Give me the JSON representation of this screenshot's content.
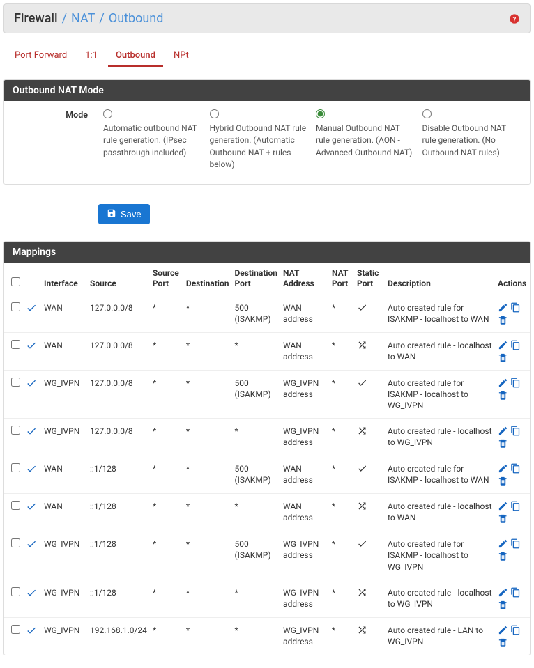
{
  "header": {
    "root": "Firewall",
    "segments": [
      "NAT",
      "Outbound"
    ]
  },
  "tabs": [
    {
      "label": "Port Forward",
      "active": false
    },
    {
      "label": "1:1",
      "active": false
    },
    {
      "label": "Outbound",
      "active": true
    },
    {
      "label": "NPt",
      "active": false
    }
  ],
  "mode_panel": {
    "title": "Outbound NAT Mode",
    "label": "Mode",
    "options": [
      {
        "desc": "Automatic outbound NAT rule generation. (IPsec passthrough included)",
        "selected": false
      },
      {
        "desc": "Hybrid Outbound NAT rule generation. (Automatic Outbound NAT + rules below)",
        "selected": false
      },
      {
        "desc": "Manual Outbound NAT rule generation. (AON - Advanced Outbound NAT)",
        "selected": true
      },
      {
        "desc": "Disable Outbound NAT rule generation. (No Outbound NAT rules)",
        "selected": false
      }
    ]
  },
  "save_label": "Save",
  "mappings_panel": {
    "title": "Mappings",
    "columns": [
      "",
      "",
      "Interface",
      "Source",
      "Source Port",
      "Destination",
      "Destination Port",
      "NAT Address",
      "NAT Port",
      "Static Port",
      "Description",
      "Actions"
    ],
    "rows": [
      {
        "interface": "WAN",
        "source": "127.0.0.0/8",
        "srcport": "*",
        "dst": "*",
        "dstport": "500 (ISAKMP)",
        "nataddr": "WAN address",
        "natport": "*",
        "static": "check",
        "desc": "Auto created rule for ISAKMP - localhost to WAN"
      },
      {
        "interface": "WAN",
        "source": "127.0.0.0/8",
        "srcport": "*",
        "dst": "*",
        "dstport": "*",
        "nataddr": "WAN address",
        "natport": "*",
        "static": "shuffle",
        "desc": "Auto created rule - localhost to WAN"
      },
      {
        "interface": "WG_IVPN",
        "source": "127.0.0.0/8",
        "srcport": "*",
        "dst": "*",
        "dstport": "500 (ISAKMP)",
        "nataddr": "WG_IVPN address",
        "natport": "*",
        "static": "check",
        "desc": "Auto created rule for ISAKMP - localhost to WG_IVPN"
      },
      {
        "interface": "WG_IVPN",
        "source": "127.0.0.0/8",
        "srcport": "*",
        "dst": "*",
        "dstport": "*",
        "nataddr": "WG_IVPN address",
        "natport": "*",
        "static": "shuffle",
        "desc": "Auto created rule - localhost to WG_IVPN"
      },
      {
        "interface": "WAN",
        "source": "::1/128",
        "srcport": "*",
        "dst": "*",
        "dstport": "500 (ISAKMP)",
        "nataddr": "WAN address",
        "natport": "*",
        "static": "check",
        "desc": "Auto created rule for ISAKMP - localhost to WAN"
      },
      {
        "interface": "WAN",
        "source": "::1/128",
        "srcport": "*",
        "dst": "*",
        "dstport": "*",
        "nataddr": "WAN address",
        "natport": "*",
        "static": "shuffle",
        "desc": "Auto created rule - localhost to WAN"
      },
      {
        "interface": "WG_IVPN",
        "source": "::1/128",
        "srcport": "*",
        "dst": "*",
        "dstport": "500 (ISAKMP)",
        "nataddr": "WG_IVPN address",
        "natport": "*",
        "static": "check",
        "desc": "Auto created rule for ISAKMP - localhost to WG_IVPN"
      },
      {
        "interface": "WG_IVPN",
        "source": "::1/128",
        "srcport": "*",
        "dst": "*",
        "dstport": "*",
        "nataddr": "WG_IVPN address",
        "natport": "*",
        "static": "shuffle",
        "desc": "Auto created rule - localhost to WG_IVPN"
      },
      {
        "interface": "WG_IVPN",
        "source": "192.168.1.0/24",
        "srcport": "*",
        "dst": "*",
        "dstport": "*",
        "nataddr": "WG_IVPN address",
        "natport": "*",
        "static": "shuffle",
        "desc": "Auto created rule - LAN to WG_IVPN"
      }
    ]
  }
}
